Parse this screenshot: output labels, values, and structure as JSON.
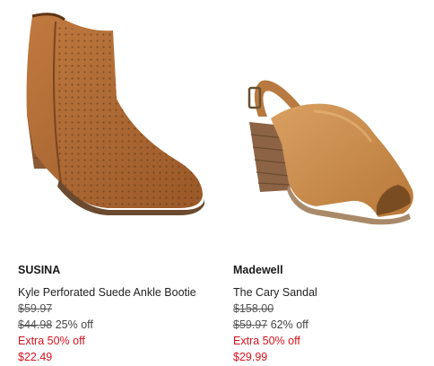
{
  "products": [
    {
      "brand": "SUSINA",
      "name": "Kyle Perforated Suede Ankle Bootie",
      "original_price": "$59.97",
      "compare_price": "$44.98",
      "discount": "25% off",
      "extra_offer": "Extra 50% off",
      "final_price": "$22.49",
      "image_icon": "ankle-bootie-image"
    },
    {
      "brand": "Madewell",
      "name": "The Cary Sandal",
      "original_price": "$158.00",
      "compare_price": "$59.97",
      "discount": "62% off",
      "extra_offer": "Extra 50% off",
      "final_price": "$29.99",
      "image_icon": "slingback-sandal-image"
    }
  ],
  "colors": {
    "sale_red": "#d4141e",
    "bootie_suede": "#b06a35",
    "sandal_leather": "#c98a4b"
  }
}
